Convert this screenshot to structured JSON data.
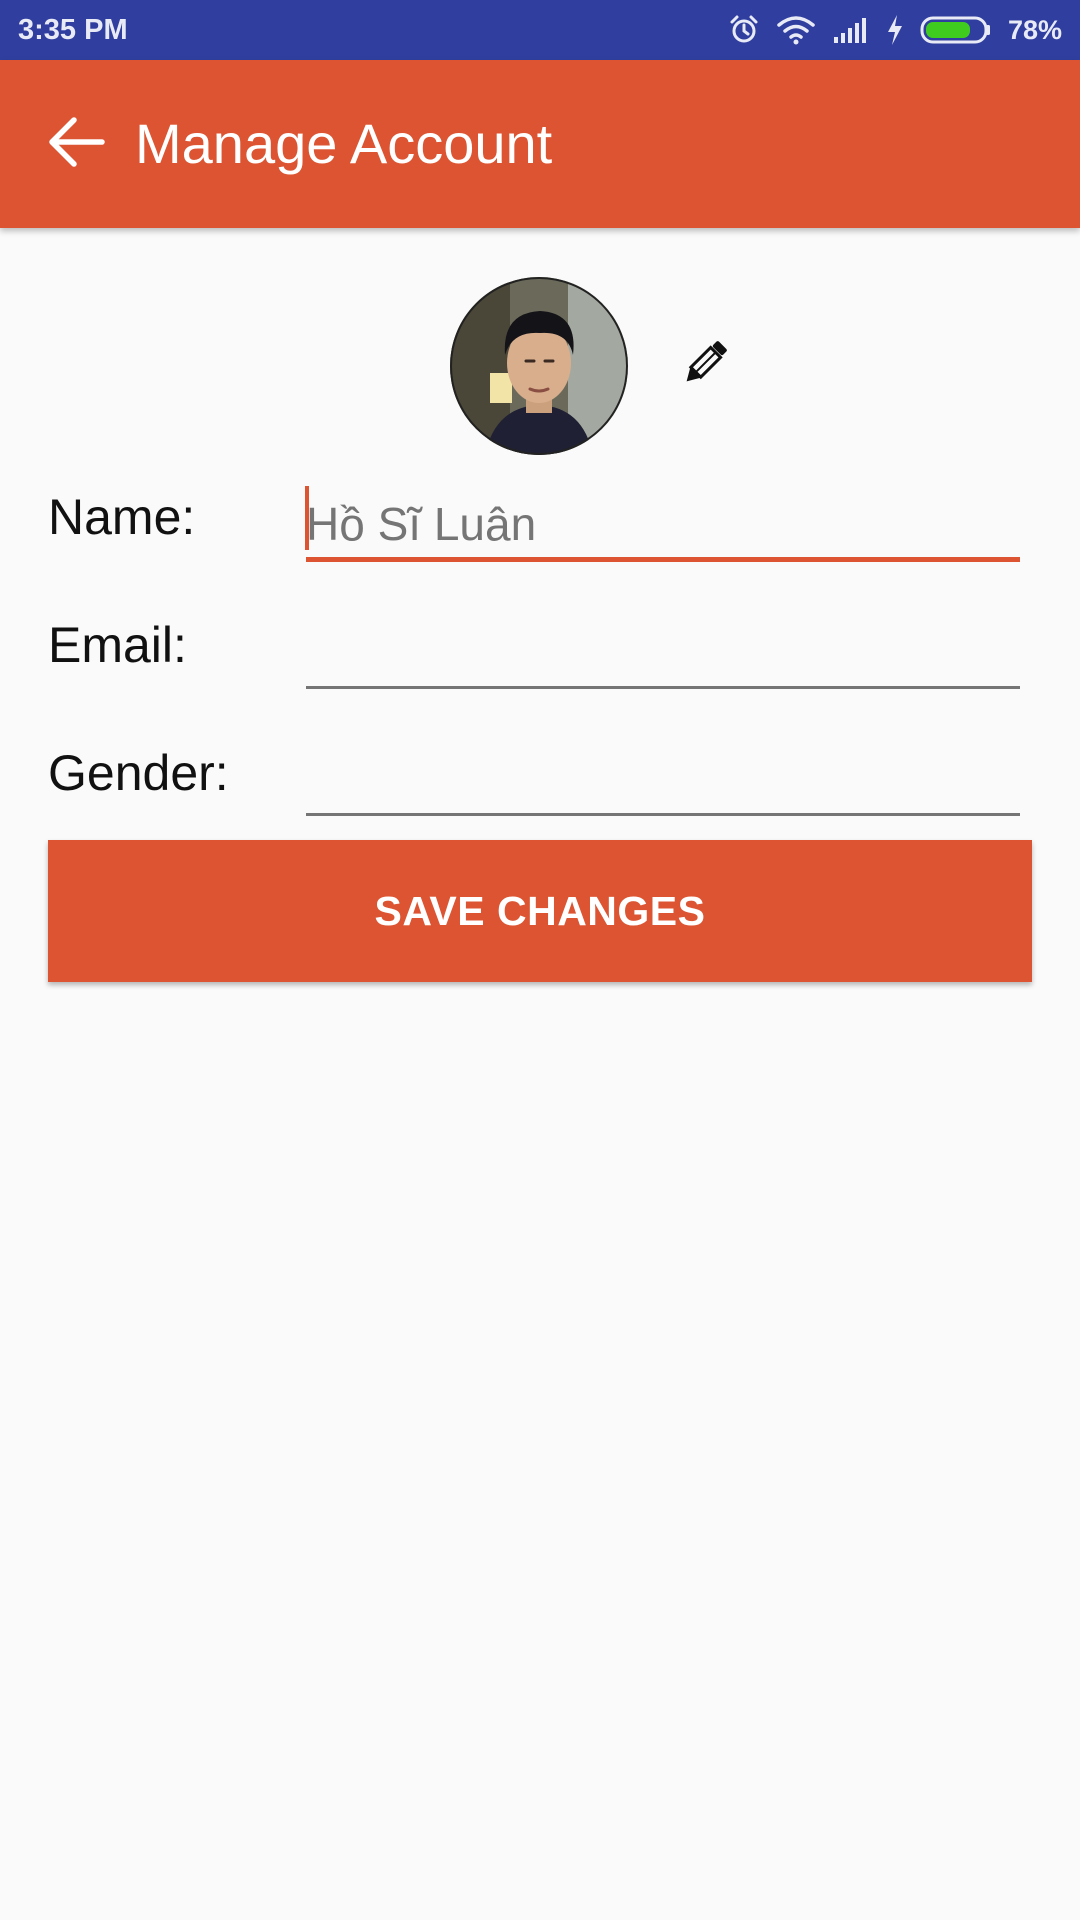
{
  "status_bar": {
    "time": "3:35 PM",
    "battery_percent": "78%",
    "battery_level": 0.78,
    "icons": [
      "alarm-icon",
      "wifi-icon",
      "signal-icon",
      "charging-icon",
      "battery-icon"
    ],
    "background_color": "#303f9f"
  },
  "app_bar": {
    "title": "Manage Account",
    "back_icon": "arrow-back-icon",
    "background_color": "#dc5431"
  },
  "profile": {
    "avatar": "profile-photo",
    "edit_icon": "pencil-icon"
  },
  "form": {
    "name": {
      "label": "Name:",
      "placeholder": "Hồ Sĩ Luân",
      "value": ""
    },
    "email": {
      "label": "Email:",
      "placeholder": "",
      "value": ""
    },
    "gender": {
      "label": "Gender:",
      "placeholder": "",
      "value": ""
    }
  },
  "actions": {
    "save_label": "SAVE CHANGES"
  },
  "colors": {
    "accent": "#dc5431",
    "status_bar": "#303f9f",
    "background": "#fafafa"
  }
}
